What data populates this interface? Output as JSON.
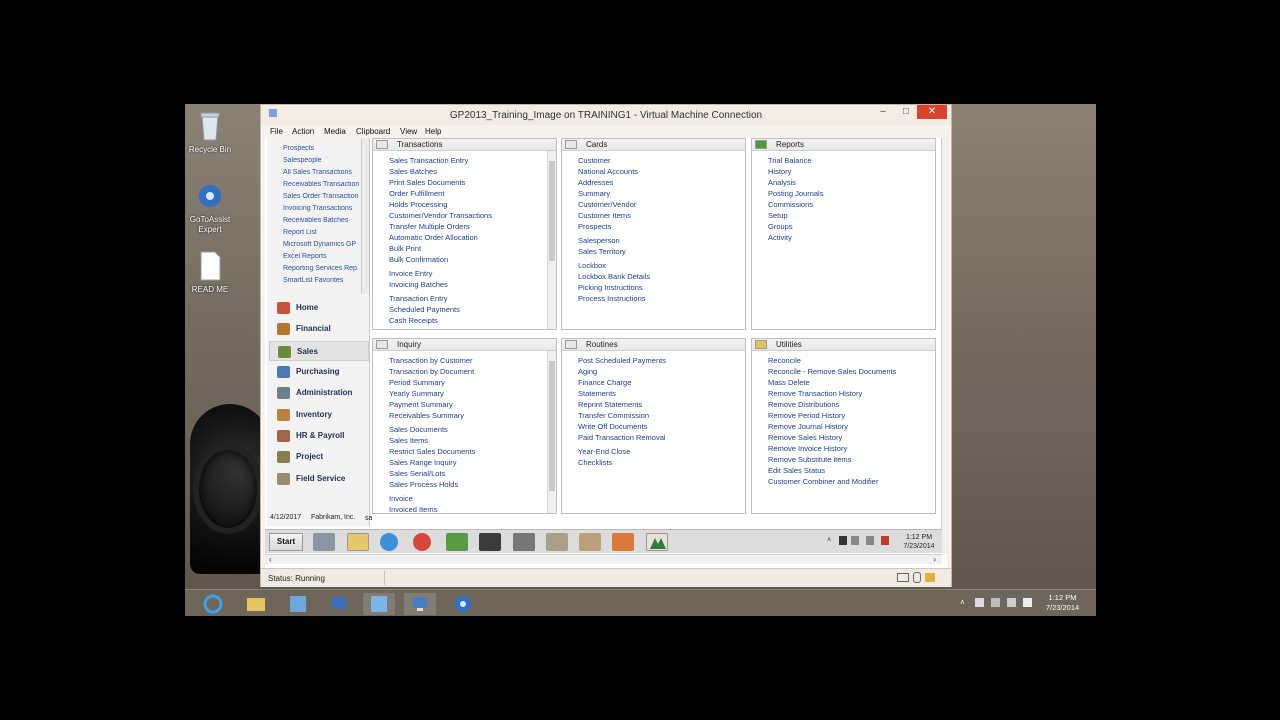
{
  "host": {
    "desktop_icons": [
      {
        "label": "Recycle Bin",
        "icon": "recycle-bin-icon"
      },
      {
        "label": "GoToAssist Expert",
        "icon": "gotoassist-icon"
      },
      {
        "label": "READ ME",
        "icon": "document-icon"
      }
    ],
    "clock_time": "1:12 PM",
    "clock_date": "7/23/2014"
  },
  "vm": {
    "title": "GP2013_Training_Image on TRAINING1 - Virtual Machine Connection",
    "menu": [
      "File",
      "Action",
      "Media",
      "Clipboard",
      "View",
      "Help"
    ],
    "status": "Status: Running"
  },
  "nav": {
    "links": [
      "Prospects",
      "Salespeople",
      "All Sales Transactions",
      "Receivables Transaction",
      "Sales Order Transaction",
      "Invoicing Transactions",
      "Receivables Batches",
      "Report List",
      "Microsoft Dynamics GP",
      "Excel Reports",
      "Reporting Services Rep.",
      "SmartList Favorites"
    ],
    "sections": [
      "Home",
      "Financial",
      "Sales",
      "Purchasing",
      "Administration",
      "Inventory",
      "HR & Payroll",
      "Project",
      "Field Service"
    ],
    "selected": "Sales"
  },
  "panels": {
    "transactions": {
      "title": "Transactions",
      "items": [
        "Sales Transaction Entry",
        "Sales Batches",
        "Print Sales Documents",
        "Order Fulfillment",
        "Holds Processing",
        "Customer/Vendor Transactions",
        "Transfer Multiple Orders",
        "Automatic Order Allocation",
        "Bulk Print",
        "Bulk Confirmation",
        "Invoice Entry",
        "Invoicing Batches",
        "Transaction Entry",
        "Scheduled Payments",
        "Cash Receipts"
      ]
    },
    "cards": {
      "title": "Cards",
      "items": [
        "Customer",
        "National Accounts",
        "Addresses",
        "Summary",
        "Customer/Vendor",
        "Customer Items",
        "Prospects",
        "Salesperson",
        "Sales Territory",
        "Lockbox",
        "Lockbox Bank Details",
        "Picking Instructions",
        "Process Instructions"
      ]
    },
    "reports": {
      "title": "Reports",
      "items": [
        "Trial Balance",
        "History",
        "Analysis",
        "Posting Journals",
        "Commissions",
        "Setup",
        "Groups",
        "Activity"
      ]
    },
    "inquiry": {
      "title": "Inquiry",
      "items": [
        "Transaction by Customer",
        "Transaction by Document",
        "Period Summary",
        "Yearly Summary",
        "Payment Summary",
        "Receivables Summary",
        "Sales Documents",
        "Sales Items",
        "Restrict Sales Documents",
        "Sales Range Inquiry",
        "Sales Serial/Lots",
        "Sales Process Holds",
        "Invoice",
        "Invoiced Items"
      ]
    },
    "routines": {
      "title": "Routines",
      "items": [
        "Post Scheduled Payments",
        "Aging",
        "Finance Charge",
        "Statements",
        "Reprint Statements",
        "Transfer Commission",
        "Write Off Documents",
        "Paid Transaction Removal",
        "Year-End Close",
        "Checklists"
      ]
    },
    "utilities": {
      "title": "Utilities",
      "items": [
        "Reconcile",
        "Reconcile - Remove Sales Documents",
        "Mass Delete",
        "Remove Transaction History",
        "Remove Distributions",
        "Remove Period History",
        "Remove Journal History",
        "Remove Sales History",
        "Remove Invoice History",
        "Remove Substitute items",
        "Edit Sales Status",
        "Customer Combiner and Modifier"
      ]
    }
  },
  "guest": {
    "status_date": "4/12/2017",
    "status_company": "Fabrikam, Inc.",
    "status_user": "sa",
    "start_label": "Start",
    "clock_time": "1:12 PM",
    "clock_date": "7/23/2014"
  },
  "colors": {
    "link": "#1d3f8f",
    "close": "#d9442e"
  }
}
